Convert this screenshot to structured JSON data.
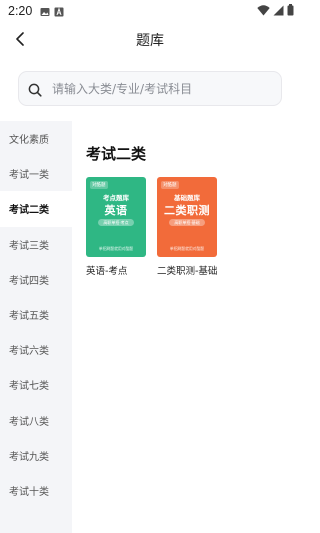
{
  "status_bar": {
    "time": "2:20",
    "left_icons": [
      "photo-icon",
      "a-icon"
    ],
    "right_icons": [
      "wifi-icon",
      "signal-icon",
      "battery-icon"
    ]
  },
  "header": {
    "title": "题库",
    "back_icon": "chevron-left-icon"
  },
  "search": {
    "placeholder": "请输入大类/专业/考试科目",
    "value": ""
  },
  "sidebar": {
    "active_index": 2,
    "items": [
      {
        "label": "文化素质"
      },
      {
        "label": "考试一类"
      },
      {
        "label": "考试二类"
      },
      {
        "label": "考试三类"
      },
      {
        "label": "考试四类"
      },
      {
        "label": "考试五类"
      },
      {
        "label": "考试六类"
      },
      {
        "label": "考试七类"
      },
      {
        "label": "考试八类"
      },
      {
        "label": "考试九类"
      },
      {
        "label": "考试十类"
      }
    ]
  },
  "main": {
    "section_title": "考试二类",
    "books": [
      {
        "cover_color": "#2fb784",
        "cover_logo": "对酷题",
        "cover_subtitle": "考点题库",
        "cover_title": "英语",
        "cover_tag": "高职单招·考点",
        "cover_footer": "单招刷题就用对酷题",
        "label": "英语-考点"
      },
      {
        "cover_color": "#f26b3a",
        "cover_logo": "对酷题",
        "cover_subtitle": "基础题库",
        "cover_title": "二类职测",
        "cover_tag": "高职单招·基础",
        "cover_footer": "单招刷题就用对酷题",
        "label": "二类职测-基础"
      }
    ]
  }
}
